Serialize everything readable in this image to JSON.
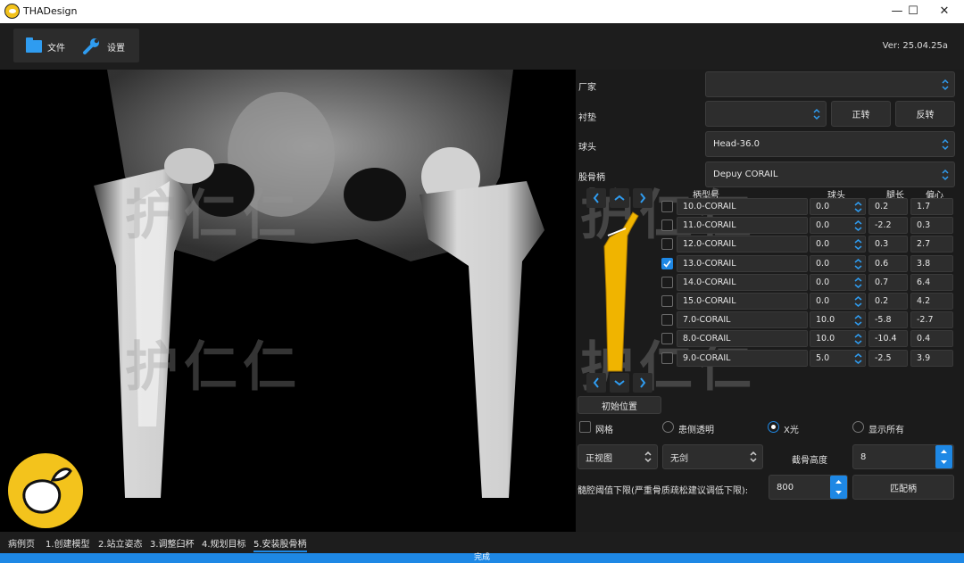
{
  "window": {
    "title": "THADesign",
    "minimize": "—",
    "maximize": "☐",
    "close": "✕"
  },
  "toolbar": {
    "file_label": "文件",
    "settings_label": "设置",
    "version": "Ver: 25.04.25a"
  },
  "viewport": {
    "watermark": [
      "护仁仁",
      "护仁仁",
      "护仁仁",
      "护仁仁"
    ]
  },
  "form": {
    "manufacturer_label": "厂家",
    "manufacturer_value": "",
    "liner_label": "衬垫",
    "liner_value": "",
    "rotate_forward": "正转",
    "rotate_reverse": "反转",
    "head_label": "球头",
    "head_value": "Head-36.0",
    "stem_label": "股骨柄",
    "stem_value": "Depuy CORAIL"
  },
  "table": {
    "headers": {
      "model": "柄型号",
      "head": "球头",
      "neck": "腿长",
      "offset": "偏心"
    },
    "rows": [
      {
        "model": "10.0-CORAIL",
        "head": "0.0",
        "neck": "0.2",
        "offset": "1.7",
        "checked": false
      },
      {
        "model": "11.0-CORAIL",
        "head": "0.0",
        "neck": "-2.2",
        "offset": "0.3",
        "checked": false
      },
      {
        "model": "12.0-CORAIL",
        "head": "0.0",
        "neck": "0.3",
        "offset": "2.7",
        "checked": false
      },
      {
        "model": "13.0-CORAIL",
        "head": "0.0",
        "neck": "0.6",
        "offset": "3.8",
        "checked": true
      },
      {
        "model": "14.0-CORAIL",
        "head": "0.0",
        "neck": "0.7",
        "offset": "6.4",
        "checked": false
      },
      {
        "model": "15.0-CORAIL",
        "head": "0.0",
        "neck": "0.2",
        "offset": "4.2",
        "checked": false
      },
      {
        "model": "7.0-CORAIL",
        "head": "10.0",
        "neck": "-5.8",
        "offset": "-2.7",
        "checked": false
      },
      {
        "model": "8.0-CORAIL",
        "head": "10.0",
        "neck": "-10.4",
        "offset": "0.4",
        "checked": false
      },
      {
        "model": "9.0-CORAIL",
        "head": "5.0",
        "neck": "-2.5",
        "offset": "3.9",
        "checked": false
      }
    ]
  },
  "reset_position": "初始位置",
  "view_options": {
    "grid": "网格",
    "contralateral": "患侧透明",
    "xray": "X光",
    "show_all": "显示所有"
  },
  "bottom": {
    "view_value": "正视图",
    "tool_value": "无剑",
    "cut_height_label": "截骨高度",
    "cut_height_value": "8",
    "threshold_label": "髓腔阈值下限(严重骨质疏松建议调低下限):",
    "threshold_value": "800",
    "match_label": "匹配柄"
  },
  "steps": [
    "病例页",
    "1.创建模型",
    "2.站立姿态",
    "3.调整臼杯",
    "4.规划目标",
    "5.安装股骨柄"
  ],
  "progress_label": "完成",
  "colors": {
    "accent": "#1e88e5",
    "implant": "#f0b400",
    "logo": "#f3c31c"
  }
}
